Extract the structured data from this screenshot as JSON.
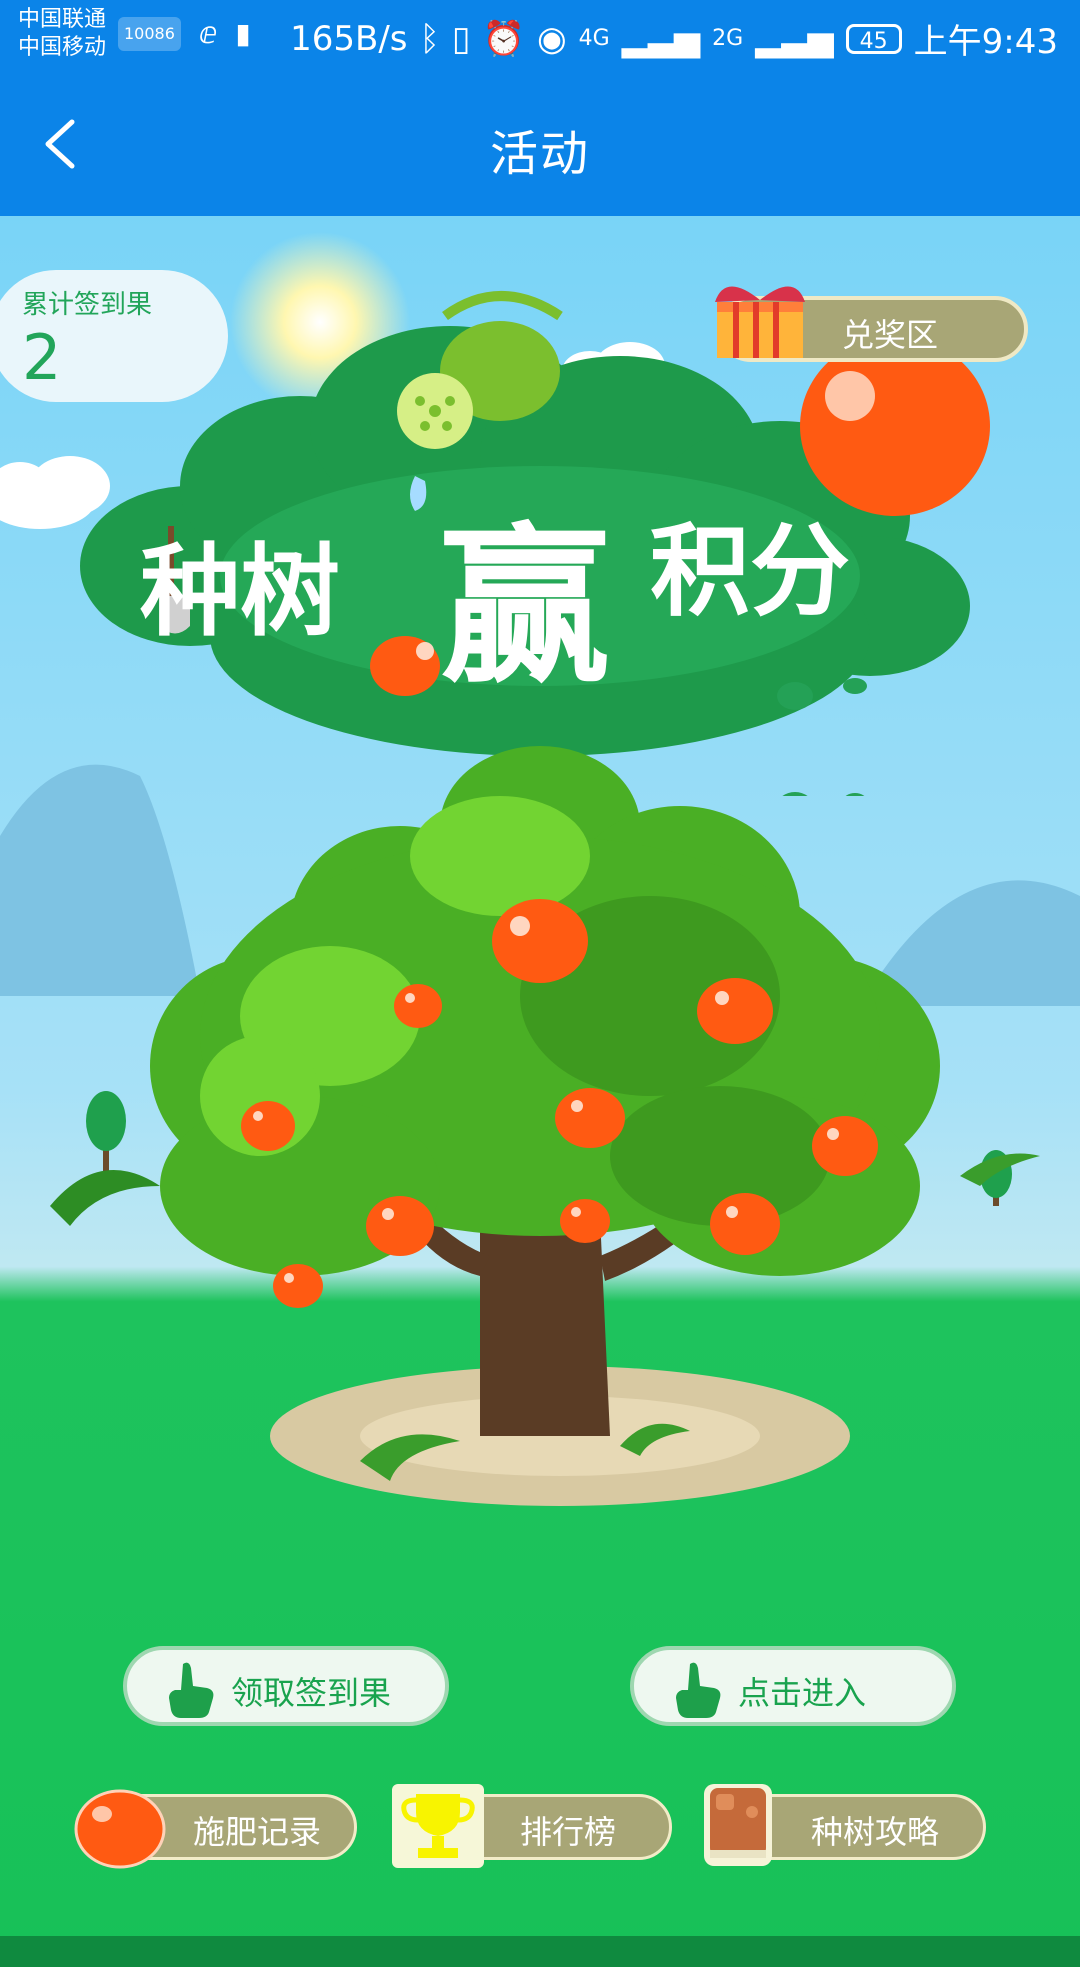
{
  "status_bar": {
    "carrier1": "中国联通",
    "carrier2": "中国移动",
    "hd_label": "10086",
    "speed": "165B/s",
    "signal1": "4G",
    "signal2": "2G",
    "battery": "45",
    "time": "上午9:43"
  },
  "header": {
    "title": "活动"
  },
  "sign_in": {
    "label": "累计签到果",
    "count": "2"
  },
  "exchange": {
    "label": "兑奖区"
  },
  "banner": {
    "text1": "种树",
    "text2": "赢",
    "text3": "积分"
  },
  "actions": {
    "collect_label": "领取签到果",
    "enter_label": "点击进入"
  },
  "bottom_nav": {
    "fertilize_label": "施肥记录",
    "ranking_label": "排行榜",
    "guide_label": "种树攻略"
  },
  "colors": {
    "header_blue": "#0b84e8",
    "green_text": "#19a34e",
    "pill_olive": "#a8a676",
    "fruit_orange": "#ff5a12"
  }
}
